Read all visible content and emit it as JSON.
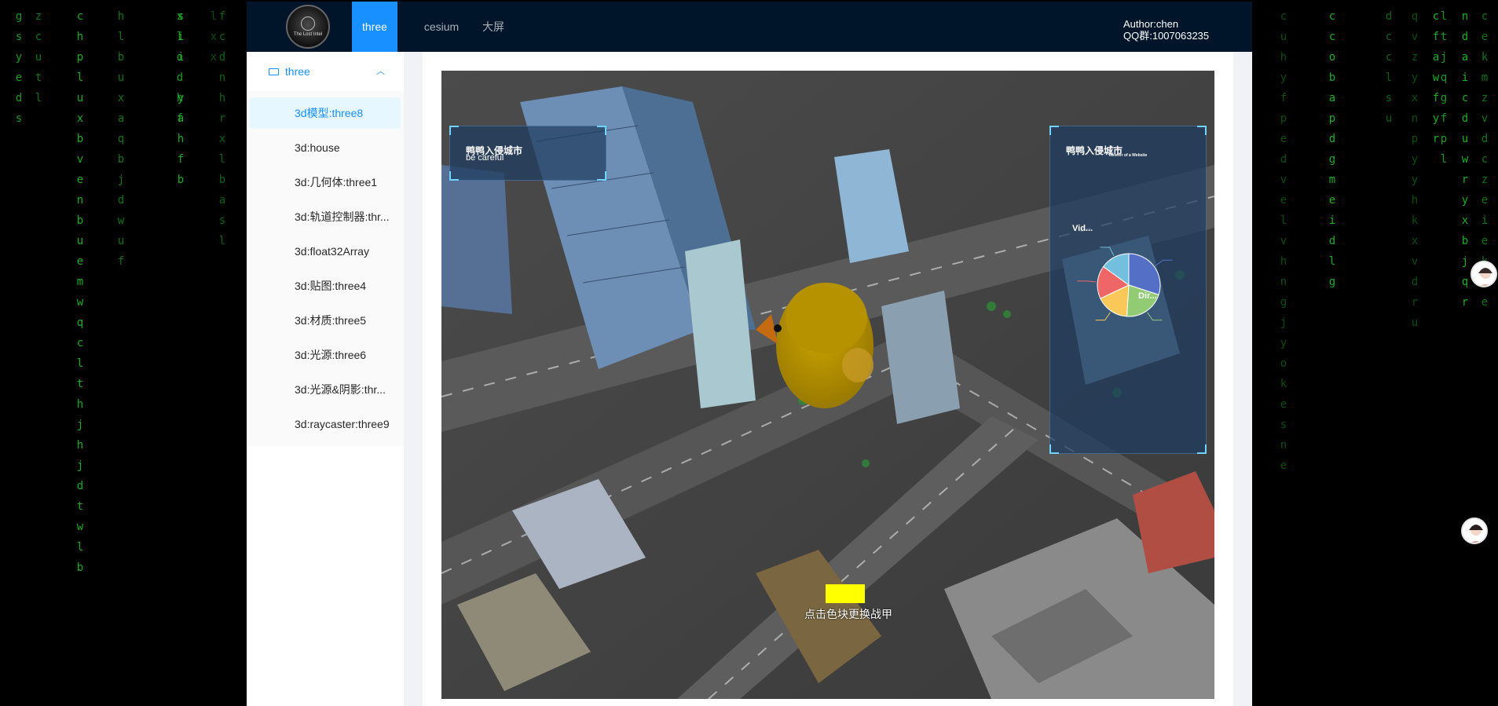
{
  "header": {
    "logo_text": "The Lost Intel",
    "tabs": [
      {
        "label": "three",
        "active": true
      },
      {
        "label": "cesium",
        "active": false
      },
      {
        "label": "大屏",
        "active": false
      }
    ],
    "author_line1": "Author:chen",
    "author_line2": "QQ群:1007063235"
  },
  "sidebar": {
    "group_label": "three",
    "items": [
      {
        "label": "3d模型:three8",
        "active": true
      },
      {
        "label": "3d:house"
      },
      {
        "label": "3d:几何体:three1"
      },
      {
        "label": "3d:轨道控制器:thr..."
      },
      {
        "label": "3d:float32Array"
      },
      {
        "label": "3d:贴图:three4"
      },
      {
        "label": "3d:材质:three5"
      },
      {
        "label": "3d:光源:three6"
      },
      {
        "label": "3d:光源&阴影:thr..."
      },
      {
        "label": "3d:raycaster:three9"
      }
    ]
  },
  "scene": {
    "left_panel_title": "鸭鸭入侵城市",
    "left_panel_sub": "be careful",
    "right_panel_title": "鸭鸭入侵城市",
    "right_panel_sub": "Referer of a Website",
    "pie_label_1": "Vid...",
    "pie_label_2": "Dir...",
    "swatch_color": "#ffff00",
    "swatch_label": "点击色块更换战甲"
  },
  "chart_data": {
    "type": "pie",
    "title": "鸭鸭入侵城市",
    "subtitle": "Referer of a Website",
    "labels": [
      "Vid...",
      "Dir..."
    ],
    "slices": [
      {
        "value": 30,
        "color": "#5470c6"
      },
      {
        "value": 21,
        "color": "#91cc75"
      },
      {
        "value": 17,
        "color": "#fac858"
      },
      {
        "value": 17,
        "color": "#ee6666"
      },
      {
        "value": 15,
        "color": "#73c0de"
      }
    ]
  },
  "matrix_left": [
    "gsyeds",
    "chpluxbvenbuemwqclthjhjdtwlb",
    "hlbuxaqbjdwuf",
    "xlodhf",
    "sii yahfb",
    "fcdnhrxlbasl",
    "zcutl",
    "lxx"
  ],
  "matrix_right": [
    "cuhyfpedvelvhngjyokesne",
    "ccobapdgmeidlg",
    "ltjqgfpl",
    "dcclsu",
    "cfawfyr",
    "ndaicduwryxbjqr",
    "cekmzvdczeiekxe",
    "qvzyxnpyyhkxvdru"
  ]
}
